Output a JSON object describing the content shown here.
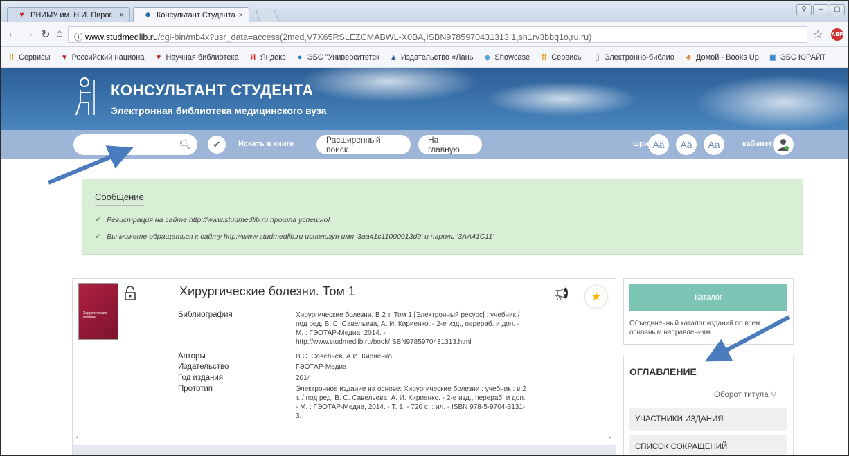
{
  "browser": {
    "tabs": [
      {
        "label": "РНИМУ им. Н.И. Пирог...",
        "close": "×"
      },
      {
        "label": "Консультант Студента. ...",
        "close": "×"
      }
    ],
    "url_domain": "www.studmedlib.ru",
    "url_path": "/cgi-bin/mb4x?usr_data=access(2med,V7X65RSLEZCMABWL-X0BA,ISBN9785970431313,1,sh1rv3bbq1o,ru,ru)",
    "url_info": "ⓘ",
    "bookmarks": [
      "Сервисы",
      "Российский национа",
      "Научная библиотека",
      "Яндекс",
      "ЭБС \"Университетск",
      "Издательство «Лань",
      "Showcase",
      "Сервисы",
      "Электронно-библио",
      "Домой - Books Up",
      "ЭБС ЮРАЙТ"
    ]
  },
  "site": {
    "title": "КОНСУЛЬТАНТ СТУДЕНТА",
    "subtitle": "Электронная библиотека медицинского вуза"
  },
  "toolbar": {
    "search_placeholder": "",
    "search_in_book": "Искать в книге",
    "advanced_search": "Расширенный поиск",
    "home": "На главную",
    "font_label": "шрифт",
    "font_btn_1": "Aä",
    "font_btn_2": "Aä",
    "font_btn_3": "Aa",
    "cabinet_label": "кабинет"
  },
  "message": {
    "title": "Сообщение",
    "lines": [
      "Регистрация на сайте http://www.studmedlib.ru прошла успешно!",
      "Вы можете обращаться к сайту http://www.studmedlib.ru используя имя '3aa41c11000013d9' и пароль '3AA41C11'"
    ]
  },
  "book": {
    "title": "Хирургические болезни. Том 1",
    "cover_text": "Хирургические болезни",
    "fields": [
      {
        "label": "Библиография",
        "value": "Хирургические болезни. В 2 т. Том 1 [Электронный ресурс] : учебник / под ред. В. С. Савельева, А. И. Кириенко. - 2-е изд., перераб. и доп. - М. : ГЭОТАР-Медиа, 2014. - http://www.studmedlib.ru/book/ISBN9785970431313.html"
      },
      {
        "label": "Авторы",
        "value": "В.С. Савельев, А.И. Кириенко"
      },
      {
        "label": "Издательство",
        "value": "ГЭОТАР-Медиа"
      },
      {
        "label": "Год издания",
        "value": "2014"
      },
      {
        "label": "Прототип",
        "value": "Электронное издание на основе: Хирургические болезни : учебник : в 2 т. / под ред. В. С. Савельева, А. И. Кириенко. - 2-е изд., перераб. и доп. - М. : ГЭОТАР-Медиа, 2014. - Т. 1. - 720 с. : ил. - ISBN 978-5-9704-3131-3."
      }
    ]
  },
  "sidebar": {
    "catalog_button": "Каталог",
    "catalog_desc": "Объединенный каталог изданий по всем основным направлениям",
    "toc_title": "ОГЛАВЛЕНИЕ",
    "toc_obor": "Оборот титула",
    "toc_items": [
      "УЧАСТНИКИ ИЗДАНИЯ",
      "СПИСОК СОКРАЩЕНИЙ"
    ]
  },
  "colors": {
    "hero": "#3c74ad",
    "toolbar": "#9db5d6",
    "message_bg": "#d8efd6",
    "catalog_btn": "#7cc4b3",
    "arrow": "#4a7bbd"
  },
  "icons": [
    "back-icon",
    "forward-icon",
    "reload-icon",
    "home-icon",
    "star-icon",
    "search-icon",
    "check-icon",
    "user-icon",
    "lock-icon",
    "megaphone-icon",
    "favorite-star-icon",
    "zoom-icon"
  ]
}
